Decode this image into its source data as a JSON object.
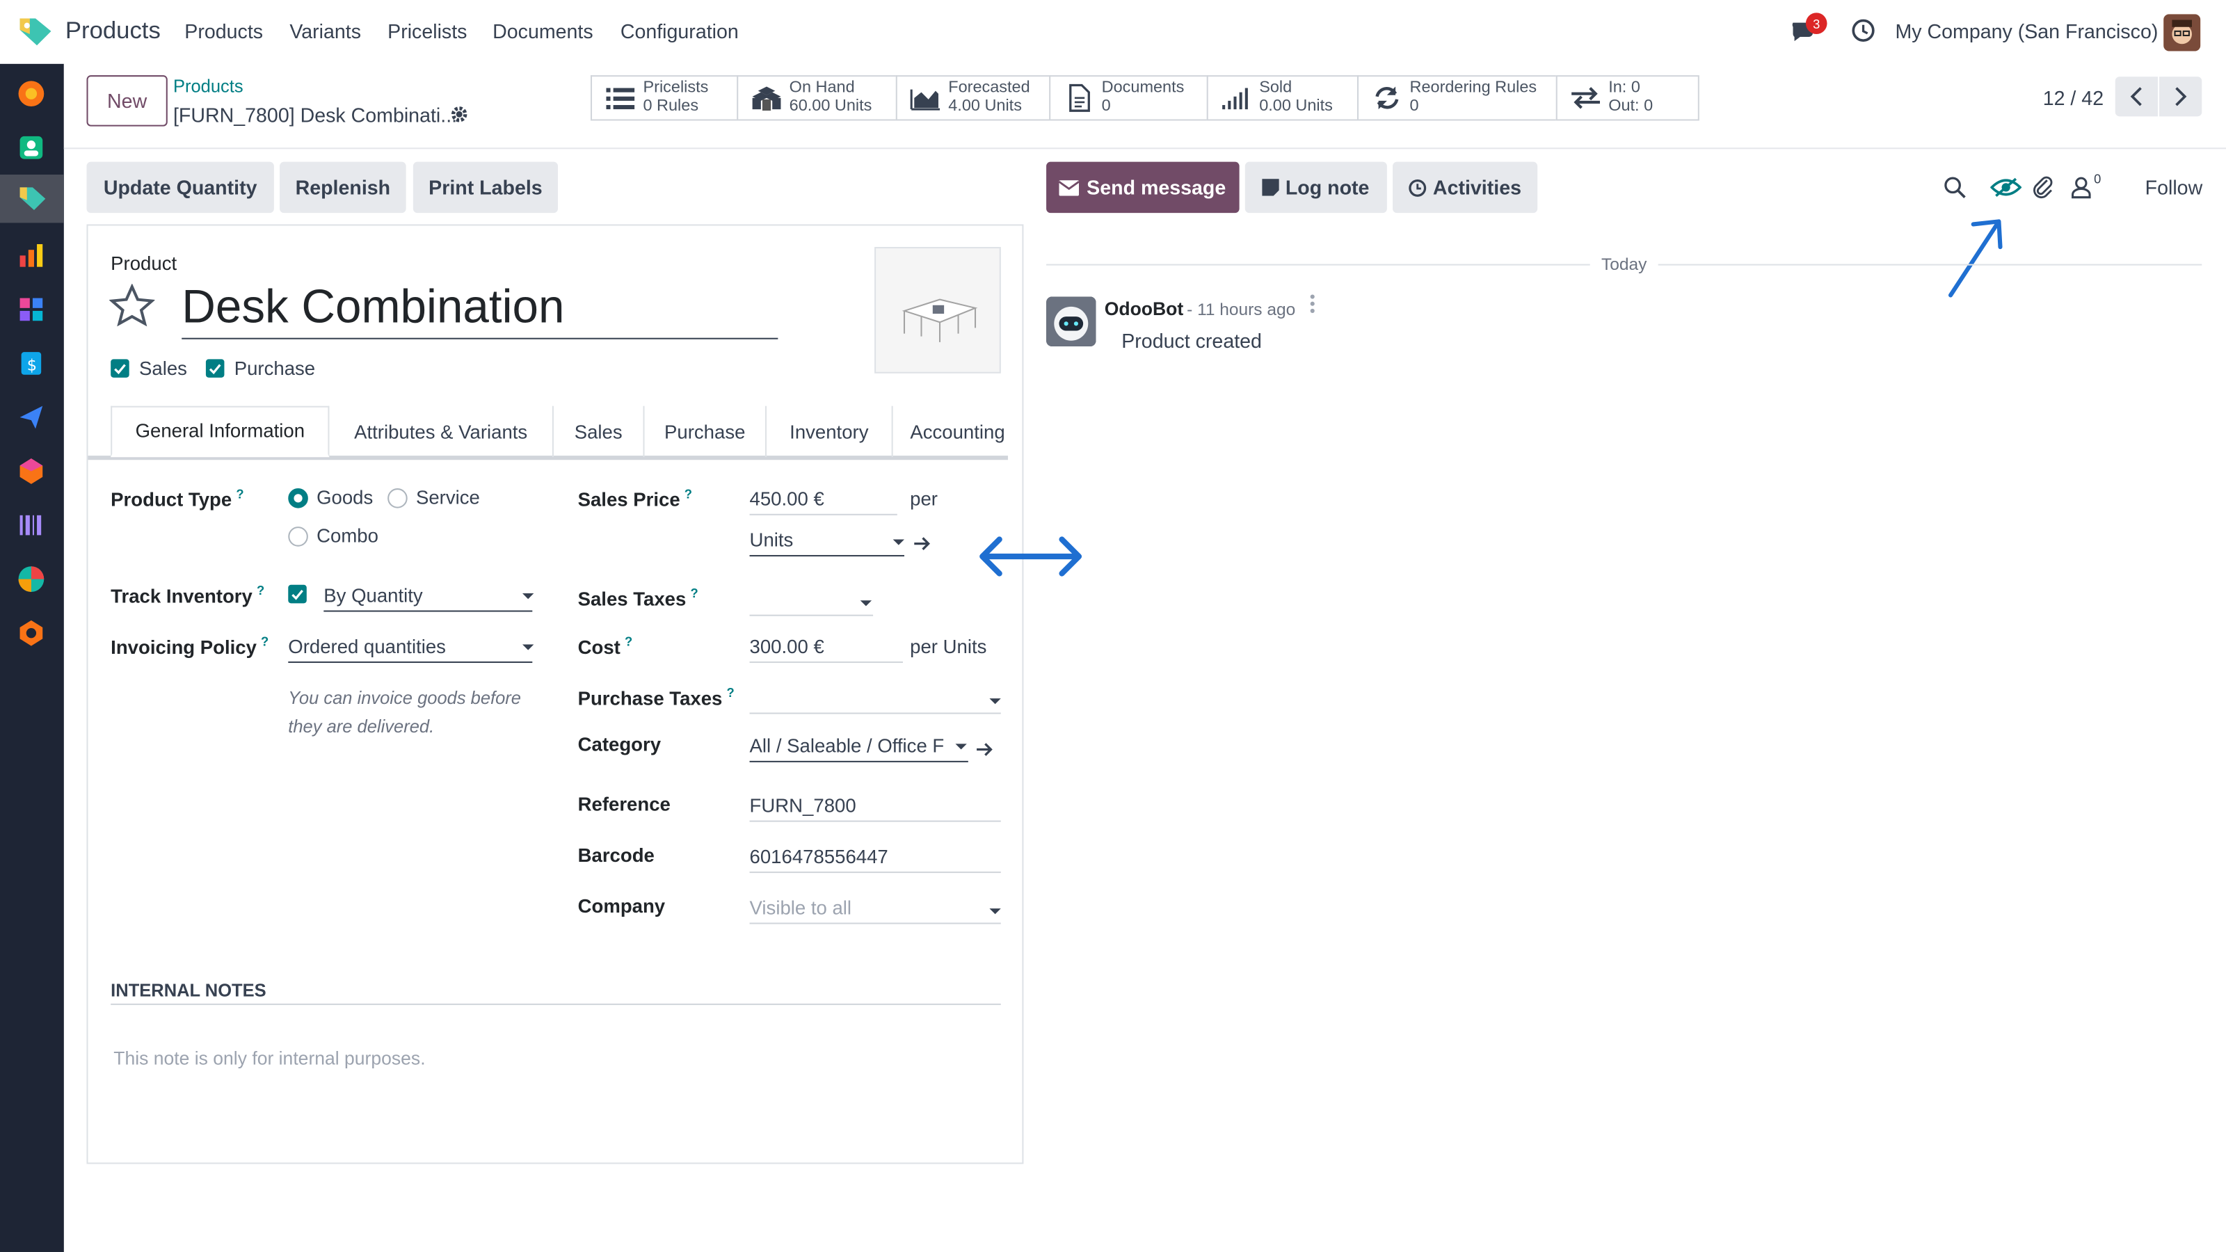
{
  "topbar": {
    "app_title": "Products",
    "menu": [
      "Products",
      "Variants",
      "Pricelists",
      "Documents",
      "Configuration"
    ],
    "messages_badge": "3",
    "company": "My Company (San Francisco)"
  },
  "breadcrumb": {
    "parent": "Products",
    "current": "[FURN_7800] Desk Combinati..."
  },
  "new_label": "New",
  "stats": [
    {
      "line1": "Pricelists",
      "line2": "0 Rules"
    },
    {
      "line1": "On Hand",
      "line2": "60.00 Units"
    },
    {
      "line1": "Forecasted",
      "line2": "4.00 Units"
    },
    {
      "line1": "Documents",
      "line2": "0"
    },
    {
      "line1": "Sold",
      "line2": "0.00 Units"
    },
    {
      "line1": "Reordering Rules",
      "line2": "0"
    },
    {
      "line1": "In: 0",
      "line2": "Out: 0"
    }
  ],
  "pager": "12 / 42",
  "actions": [
    "Update Quantity",
    "Replenish",
    "Print Labels"
  ],
  "chatter": {
    "send_message": "Send message",
    "log_note": "Log note",
    "activities": "Activities",
    "followers_count": "0",
    "follow": "Follow",
    "date_separator": "Today",
    "author": "OdooBot",
    "time": "- 11 hours ago",
    "body": "Product created"
  },
  "form": {
    "kind_label": "Product",
    "name": "Desk Combination",
    "sales_label": "Sales",
    "purchase_label": "Purchase",
    "tabs": [
      "General Information",
      "Attributes & Variants",
      "Sales",
      "Purchase",
      "Inventory",
      "Accounting"
    ],
    "product_type_label": "Product Type",
    "type_goods": "Goods",
    "type_service": "Service",
    "type_combo": "Combo",
    "track_inventory_label": "Track Inventory",
    "track_value": "By Quantity",
    "invoicing_policy_label": "Invoicing Policy",
    "invoicing_value": "Ordered quantities",
    "invoicing_hint": "You can invoice goods before they are delivered.",
    "sales_price_label": "Sales Price",
    "sales_price": "450.00 €",
    "per": "per",
    "uom": "Units",
    "sales_taxes_label": "Sales Taxes",
    "cost_label": "Cost",
    "cost": "300.00 €",
    "per_units": "per Units",
    "purchase_taxes_label": "Purchase Taxes",
    "category_label": "Category",
    "category": "All / Saleable / Office F",
    "reference_label": "Reference",
    "reference": "FURN_7800",
    "barcode_label": "Barcode",
    "barcode": "6016478556447",
    "company_label": "Company",
    "company_placeholder": "Visible to all",
    "notes_heading": "INTERNAL NOTES",
    "notes_placeholder": "This note is only for internal purposes."
  },
  "colors": {
    "brand": "#714b67",
    "accent": "#017e84",
    "annotation": "#1f6fd1"
  }
}
